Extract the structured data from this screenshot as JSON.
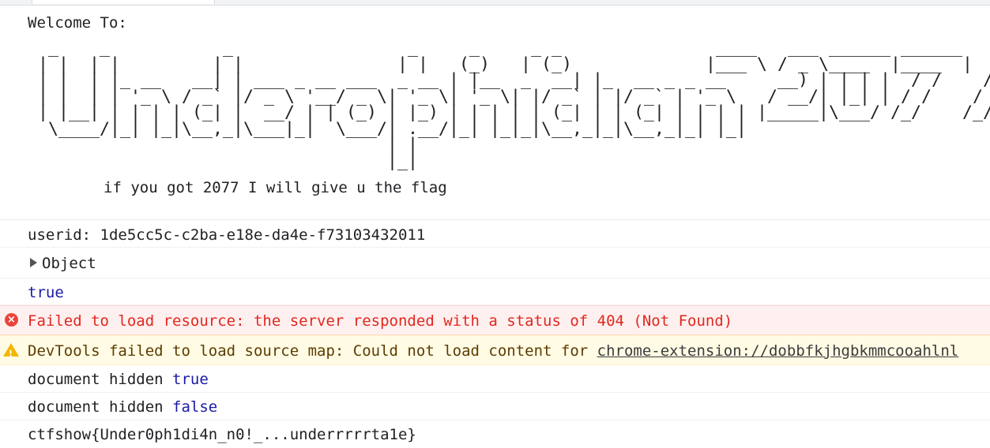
{
  "banner": {
    "welcome": "Welcome To:",
    "ascii_art": "  _    _           _                 _     _     _ _               ____   ___ ______ ______\n | |  | |         | |               | |   (_)   | (_)             |___ \\ / _ \\____  |____  |\n | |  | |_ __   __| | ___ _ __ ___  _ __ | |__  _  __| |_  __ _ _ __     __) | | | |  / /    / /\n | |  | | '_ \\ / _` |/ _ \\ '__/ _ \\| '_ \\| '_ \\| |/ _` | |/ _` | '_ \\   / __/| |_| | / /    / /\n | |__| | | | | (_| |  __/ | | (_) | |_) | | | | | (_| | | (_| | | | | |_____|\\___/ /_/    /_/\n  \\____/|_| |_|\\__,_|\\___|_|  \\___/| .__/|_| |_|_|\\__,_|_|\\__,_|_| |_|\n                                   | |\n                                   |_|",
    "tagline": "if you got 2077 I will give u the flag"
  },
  "messages": {
    "userid": "userid: 1de5cc5c-c2ba-e18e-da4e-f73103432011",
    "object_label": "Object",
    "true_value": "true",
    "error_text": "Failed to load resource: the server responded with a status of 404 (Not Found)",
    "warn_prefix": "DevTools failed to load source map: Could not load content for ",
    "warn_link": "chrome-extension://dobbfkjhgbkmmcooahlnl",
    "doc_hidden_label": "document hidden ",
    "doc_hidden_true": "true",
    "doc_hidden_false": "false",
    "flag": "ctfshow{Under0ph1di4n_n0!_...underrrrrta1e}"
  },
  "icons": {
    "error": "error-icon",
    "warning": "warning-icon",
    "expand": "expand-triangle-icon"
  },
  "colors": {
    "error_text": "#e0281e",
    "error_bg": "#fff0f0",
    "warn_bg": "#fffbe5",
    "keyword_blue": "#1a1aa6"
  }
}
